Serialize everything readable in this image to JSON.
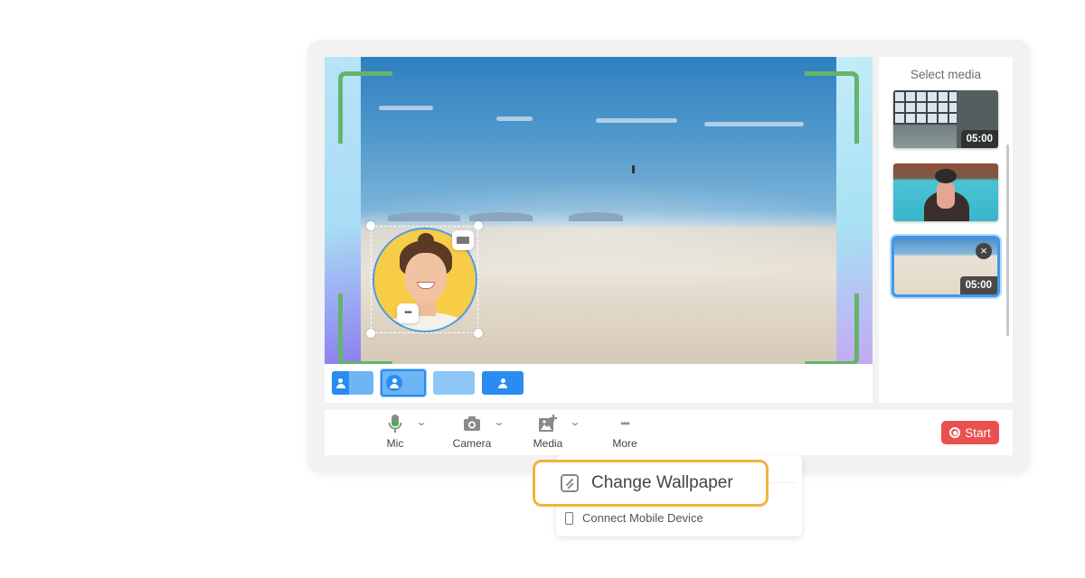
{
  "stage": {
    "overlay_buttons": {
      "keyboard_chip": "keyboard-icon",
      "more_chip": "•••"
    }
  },
  "layouts": [
    {
      "name": "layout-split-left",
      "selected": false
    },
    {
      "name": "layout-circle-avatar",
      "selected": true
    },
    {
      "name": "layout-empty",
      "selected": false
    },
    {
      "name": "layout-centered-person",
      "selected": false
    }
  ],
  "sidebar": {
    "title": "Select media",
    "items": [
      {
        "label": "Window room video",
        "duration": "05:00",
        "selected": false
      },
      {
        "label": "Kayak video",
        "duration": "",
        "selected": false
      },
      {
        "label": "Desert dunes video",
        "duration": "05:00",
        "selected": true,
        "close": "×"
      }
    ]
  },
  "toolbar": {
    "mic": "Mic",
    "camera": "Camera",
    "media": "Media",
    "more": "More",
    "more_glyph": "•••",
    "caret": "⌄",
    "start": "Start"
  },
  "colors": {
    "accent_blue": "#2a8cf0",
    "start_red": "#e8514e",
    "highlight_yellow": "#f0b43a",
    "frame_green": "#64b46a",
    "mic_green": "#4caf50"
  },
  "menu": {
    "change_wallpaper": "Change Wallpaper",
    "connect_mobile": "Connect Mobile Device"
  }
}
